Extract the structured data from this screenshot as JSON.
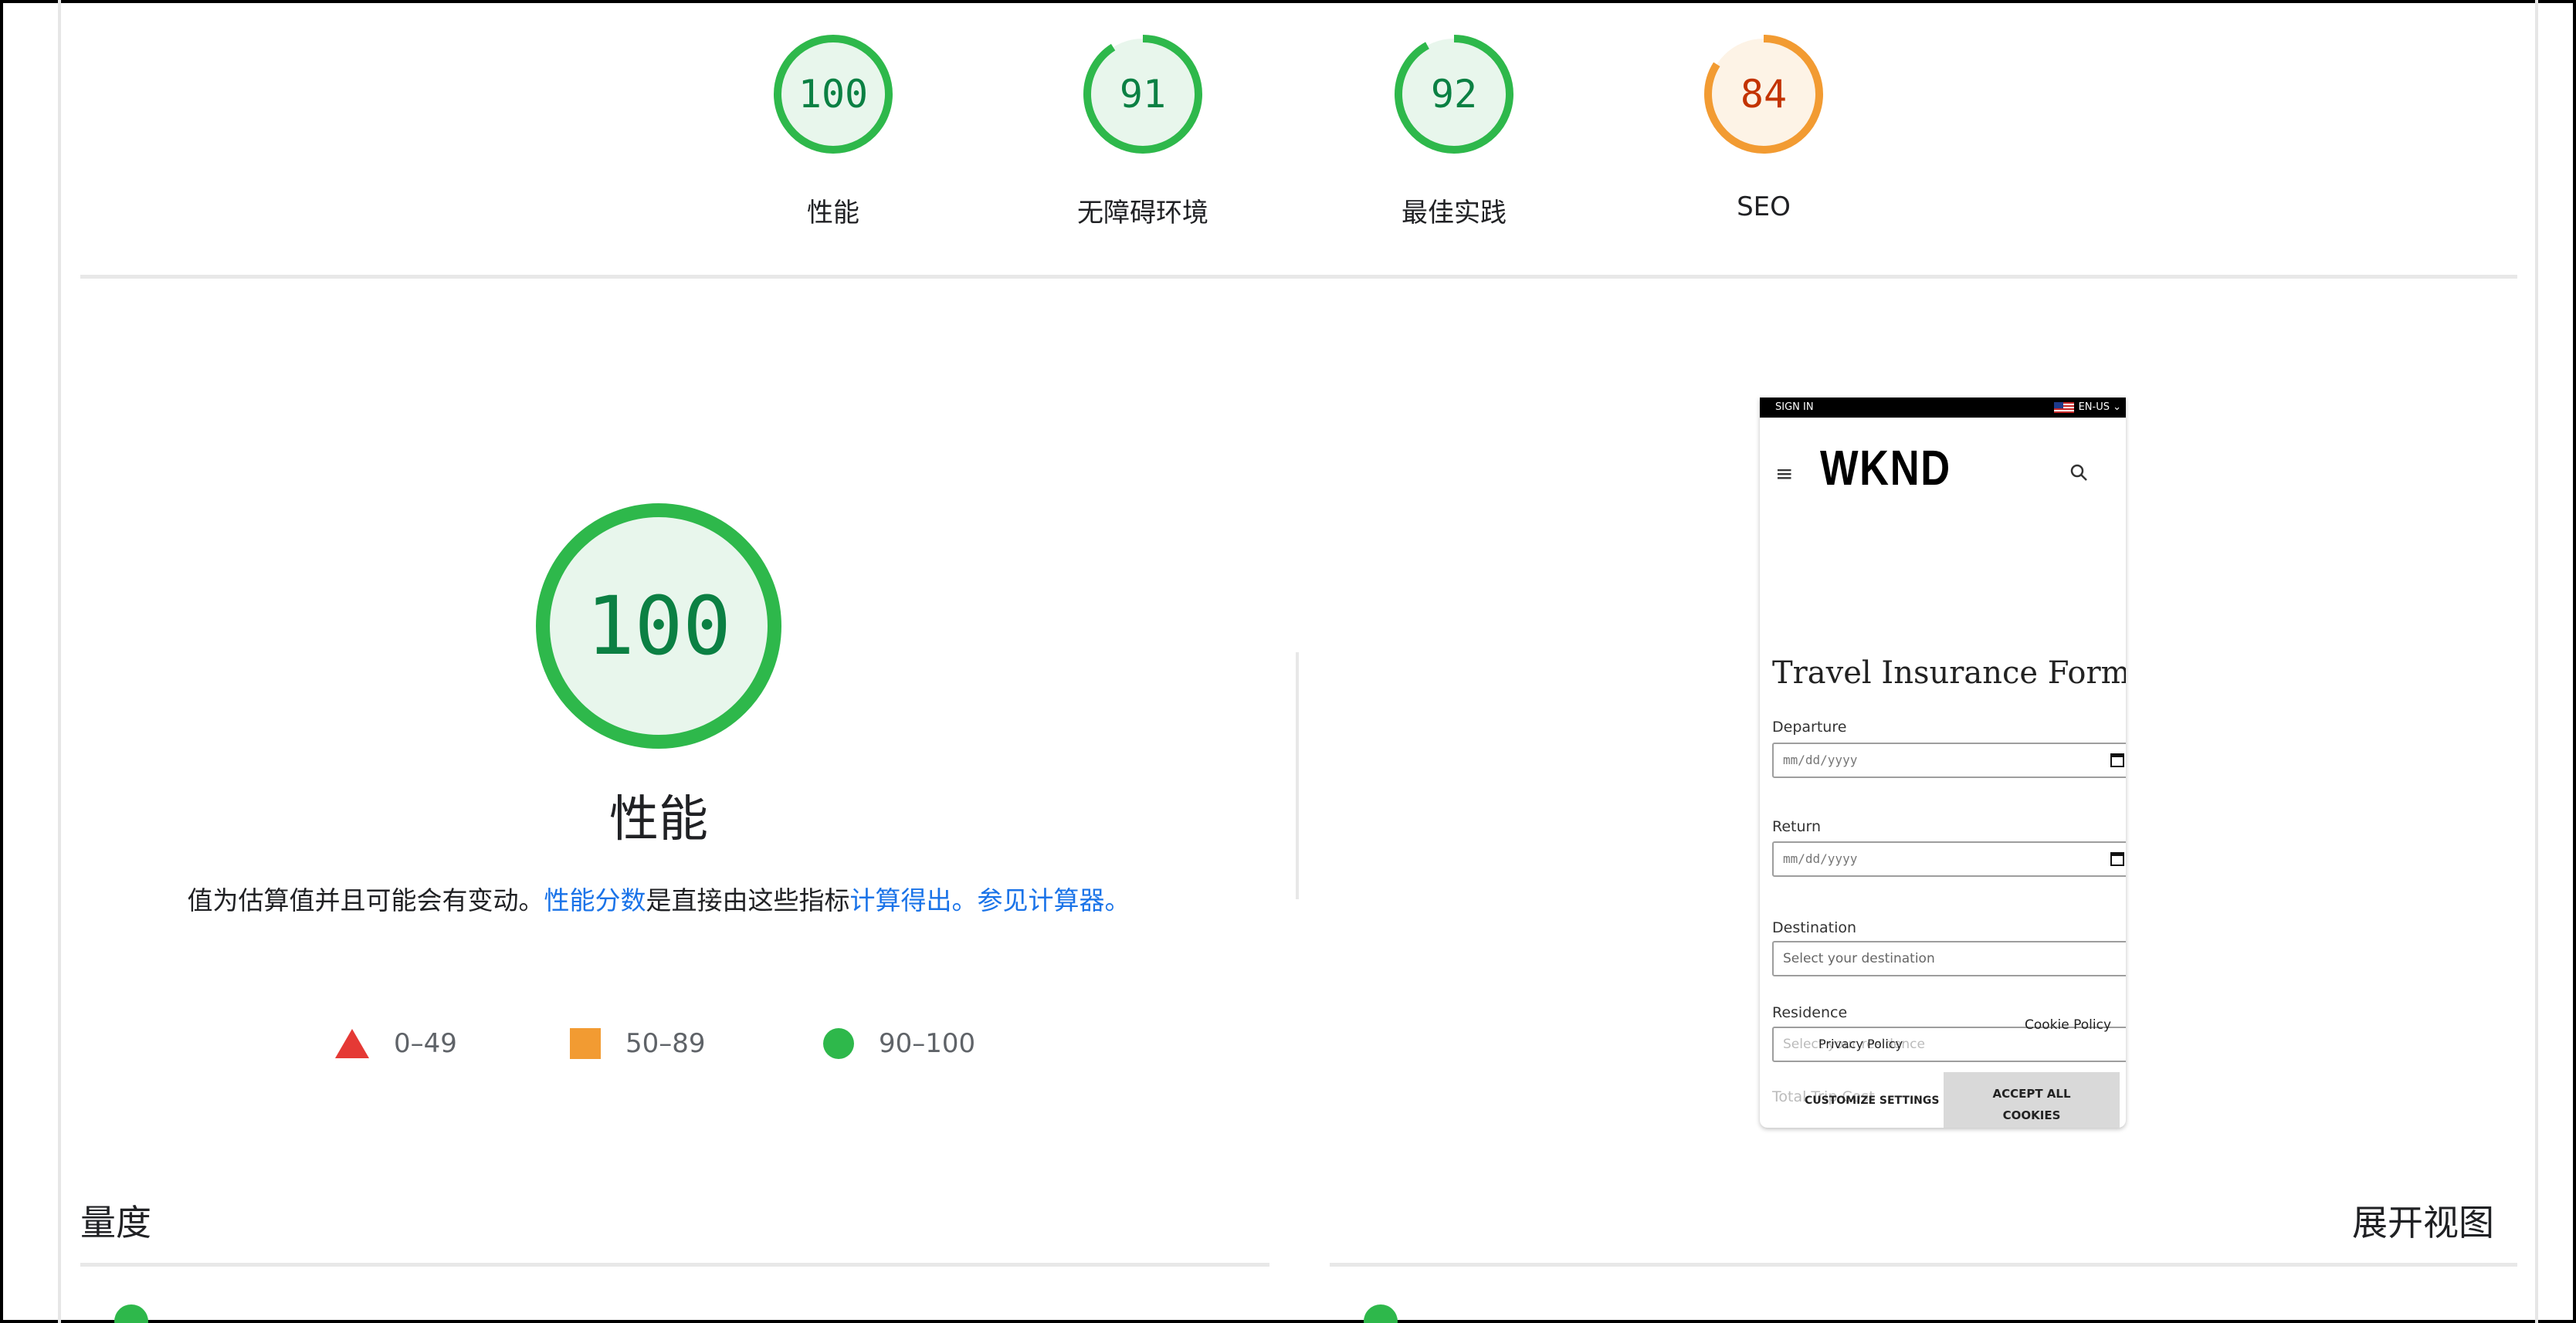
{
  "categories": [
    {
      "score": "100",
      "label": "性能",
      "score_fraction": 1.0,
      "status": "pass"
    },
    {
      "score": "91",
      "label": "无障碍环境",
      "score_fraction": 0.91,
      "status": "pass"
    },
    {
      "score": "92",
      "label": "最佳实践",
      "score_fraction": 0.92,
      "status": "pass"
    },
    {
      "score": "84",
      "label": "SEO",
      "score_fraction": 0.84,
      "status": "average"
    }
  ],
  "performance": {
    "score": "100",
    "score_fraction": 1.0,
    "title": "性能",
    "desc_part1": "值为估算值并且可能会有变动。",
    "desc_link1": "性能分数",
    "desc_part2": "是直接由这些指标",
    "desc_link2": "计算得出。",
    "desc_link3": "参见计算器。"
  },
  "legend": [
    {
      "range": "0–49",
      "shape": "triangle",
      "color": "#e53935"
    },
    {
      "range": "50–89",
      "shape": "square",
      "color": "#f29b32"
    },
    {
      "range": "90–100",
      "shape": "circle",
      "color": "#2eb84b"
    }
  ],
  "screenshot": {
    "sign_in": "SIGN IN",
    "lang": "EN-US",
    "logo": "WKND",
    "form_title": "Travel Insurance Form",
    "departure_label": "Departure",
    "departure_placeholder": "mm/dd/yyyy",
    "return_label": "Return",
    "return_placeholder": "mm/dd/yyyy",
    "destination_label": "Destination",
    "destination_value": "Select your destination",
    "residence_label": "Residence",
    "residence_value": "Select your residence",
    "cookie_policy": "Cookie Policy",
    "privacy_policy": "Privacy Policy",
    "total_trip_cost": "Total Trip Cost",
    "customize_settings": "CUSTOMIZE SETTINGS",
    "accept_all_cookies_line1": "ACCEPT ALL",
    "accept_all_cookies_line2": "COOKIES"
  },
  "metrics": {
    "title": "量度",
    "expand_view": "展开视图"
  },
  "colors": {
    "pass": "#2eb84b",
    "pass_bg": "#e8f6ec",
    "pass_text": "#0b8043",
    "average": "#f29b32",
    "average_bg": "#fdf3e6",
    "average_text": "#c33300",
    "link": "#1a73e8"
  }
}
